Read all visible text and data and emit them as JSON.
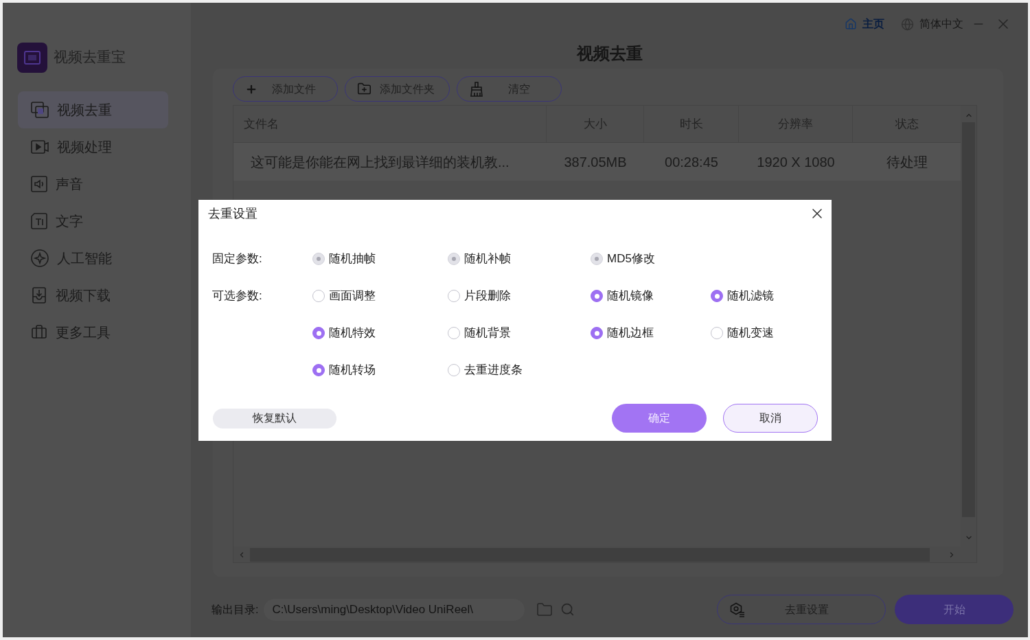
{
  "window": {
    "app_name": "视频去重宝",
    "title": "视频去重",
    "home_link": "主页",
    "language": "简体中文"
  },
  "sidebar": {
    "items": [
      {
        "label": "视频去重",
        "selected": true
      },
      {
        "label": "视频处理",
        "selected": false
      },
      {
        "label": "声音",
        "selected": false
      },
      {
        "label": "文字",
        "selected": false
      },
      {
        "label": "人工智能",
        "selected": false
      },
      {
        "label": "视频下载",
        "selected": false
      },
      {
        "label": "更多工具",
        "selected": false
      }
    ]
  },
  "toolbar": {
    "buttons": [
      {
        "label": "添加文件"
      },
      {
        "label": "添加文件夹"
      },
      {
        "label": "清空"
      }
    ]
  },
  "table": {
    "columns": [
      "文件名",
      "大小",
      "时长",
      "分辨率",
      "状态"
    ],
    "rows": [
      [
        "这可能是你能在网上找到最详细的装机教...",
        "387.05MB",
        "00:28:45",
        "1920 X 1080",
        "待处理"
      ]
    ]
  },
  "output": {
    "label": "输出目录:",
    "path": "C:\\Users\\ming\\Desktop\\Video UniReel\\"
  },
  "actions": [
    {
      "label": "去重设置",
      "kind": "settings"
    },
    {
      "label": "开始",
      "kind": "start"
    }
  ],
  "dialog": {
    "title": "去重设置",
    "groups": [
      {
        "label": "固定参数:",
        "options": [
          {
            "label": "随机抽帧",
            "checked": true,
            "disabled": true
          },
          {
            "label": "随机补帧",
            "checked": true,
            "disabled": true
          },
          {
            "label": "MD5修改",
            "checked": true,
            "disabled": true
          }
        ]
      },
      {
        "label": "可选参数:",
        "options": [
          {
            "label": "画面调整",
            "checked": false,
            "disabled": false
          },
          {
            "label": "片段删除",
            "checked": false,
            "disabled": false
          },
          {
            "label": "随机镜像",
            "checked": true,
            "disabled": false
          },
          {
            "label": "随机滤镜",
            "checked": true,
            "disabled": false
          },
          {
            "label": "随机特效",
            "checked": true,
            "disabled": false
          },
          {
            "label": "随机背景",
            "checked": false,
            "disabled": false
          },
          {
            "label": "随机边框",
            "checked": true,
            "disabled": false
          },
          {
            "label": "随机变速",
            "checked": false,
            "disabled": false
          },
          {
            "label": "随机转场",
            "checked": true,
            "disabled": false
          },
          {
            "label": "去重进度条",
            "checked": false,
            "disabled": false
          }
        ]
      }
    ],
    "buttons": [
      {
        "label": "恢复默认",
        "kind": "reset"
      },
      {
        "label": "确定",
        "kind": "primary"
      },
      {
        "label": "取消",
        "kind": "cancel"
      }
    ]
  }
}
